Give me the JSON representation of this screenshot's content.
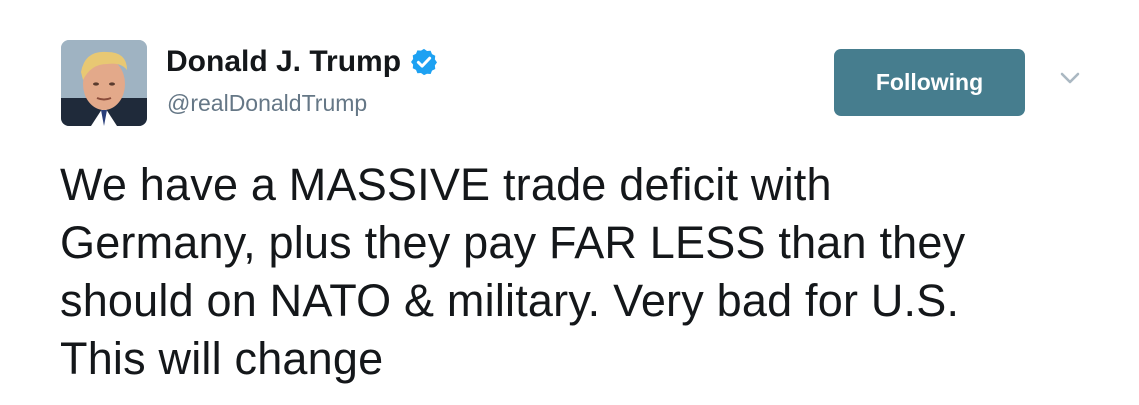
{
  "author": {
    "name": "Donald J. Trump",
    "handle": "@realDonaldTrump",
    "verified": true,
    "avatar": "profile-photo"
  },
  "actions": {
    "follow_label": "Following",
    "menu_icon": "chevron-down-icon"
  },
  "tweet": {
    "lines": [
      "We have a MASSIVE trade deficit with",
      "Germany, plus they pay FAR LESS than they",
      "should on NATO & military. Very bad for U.S.",
      "This will change"
    ]
  },
  "colors": {
    "text": "#14171a",
    "handle": "#657786",
    "verified_badge": "#1da1f2",
    "button_bg": "#467d8e",
    "button_text": "#ffffff",
    "caret": "#aab8c2"
  }
}
